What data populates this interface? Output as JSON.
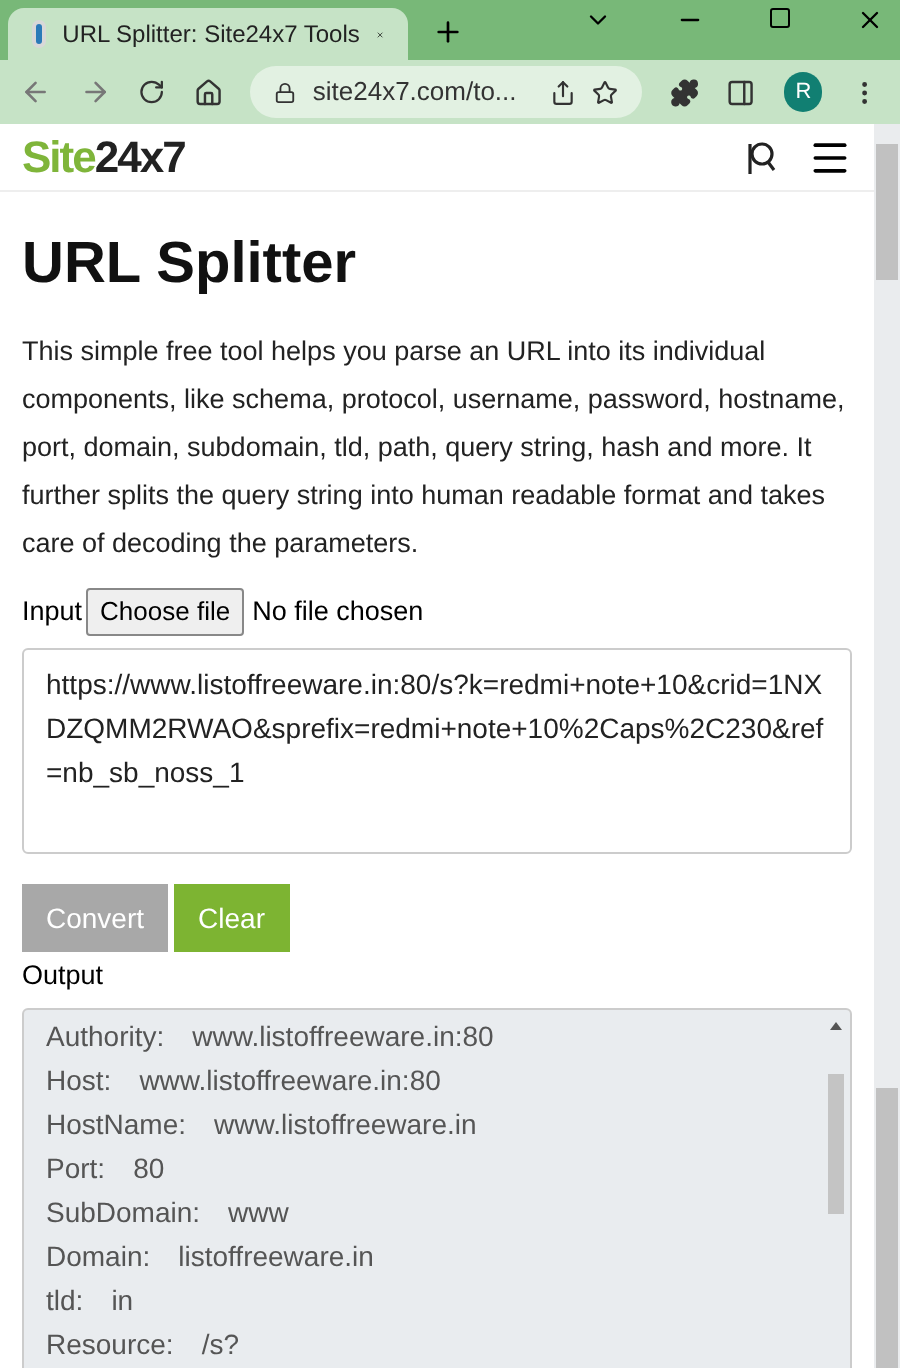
{
  "browser": {
    "tab_title": "URL Splitter: Site24x7 Tools",
    "address": "site24x7.com/to...",
    "profile_initial": "R"
  },
  "header": {
    "logo_green": "Site",
    "logo_dark": "24x7"
  },
  "title": "URL Splitter",
  "description": "This simple free tool helps you parse an URL into its individual components, like schema, protocol, username, password, hostname, port, domain, subdomain, tld, path, query string, hash and more. It further splits the query string into human readable format and takes care of decoding the parameters.",
  "input": {
    "label": "Input",
    "file_button": "Choose file",
    "file_status": "No file chosen",
    "value": "https://www.listoffreeware.in:80/s?k=redmi+note+10&crid=1NXDZQMM2RWAO&sprefix=redmi+note+10%2Caps%2C230&ref=nb_sb_noss_1"
  },
  "buttons": [
    {
      "label": "Convert",
      "kind": "secondary"
    },
    {
      "label": "Clear",
      "kind": "primary"
    }
  ],
  "output": {
    "label": "Output",
    "rows": [
      {
        "key": "Authority:",
        "value": "www.listoffreeware.in:80"
      },
      {
        "key": "Host:",
        "value": "www.listoffreeware.in:80"
      },
      {
        "key": "HostName:",
        "value": "www.listoffreeware.in"
      },
      {
        "key": "Port:",
        "value": "80"
      },
      {
        "key": "SubDomain:",
        "value": "www"
      },
      {
        "key": "Domain:",
        "value": "listoffreeware.in"
      },
      {
        "key": "tld:",
        "value": "in"
      },
      {
        "key": "Resource:",
        "value": "/s?"
      }
    ]
  }
}
